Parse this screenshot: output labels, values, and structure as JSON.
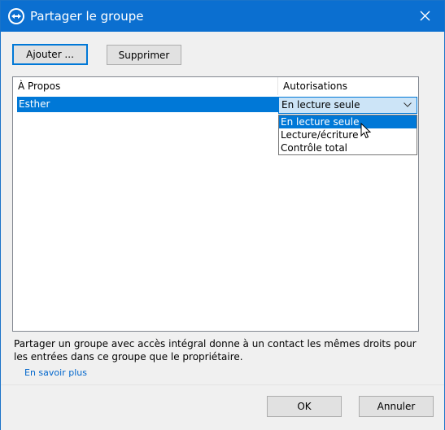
{
  "window": {
    "title": "Partager le groupe",
    "app_icon": "teamviewer-icon",
    "close_icon": "close-icon"
  },
  "toolbar": {
    "add_label": "Ajouter ...",
    "delete_label": "Supprimer"
  },
  "list": {
    "columns": [
      "À Propos",
      "Autorisations"
    ],
    "rows": [
      {
        "name": "Esther",
        "permission": "En lecture seule"
      }
    ]
  },
  "permission_dropdown": {
    "selected": "En lecture seule",
    "options": [
      "En lecture seule",
      "Lecture/écriture",
      "Contrôle total"
    ],
    "highlighted_index": 0
  },
  "description": "Partager un groupe avec accès intégral donne à un contact les mêmes droits pour les entrées dans ce groupe que le propriétaire.",
  "learn_more": "En savoir plus",
  "footer": {
    "ok_label": "OK",
    "cancel_label": "Annuler"
  },
  "colors": {
    "titlebar": "#0b6fd0",
    "selection": "#0078d7",
    "link": "#0066cc"
  }
}
